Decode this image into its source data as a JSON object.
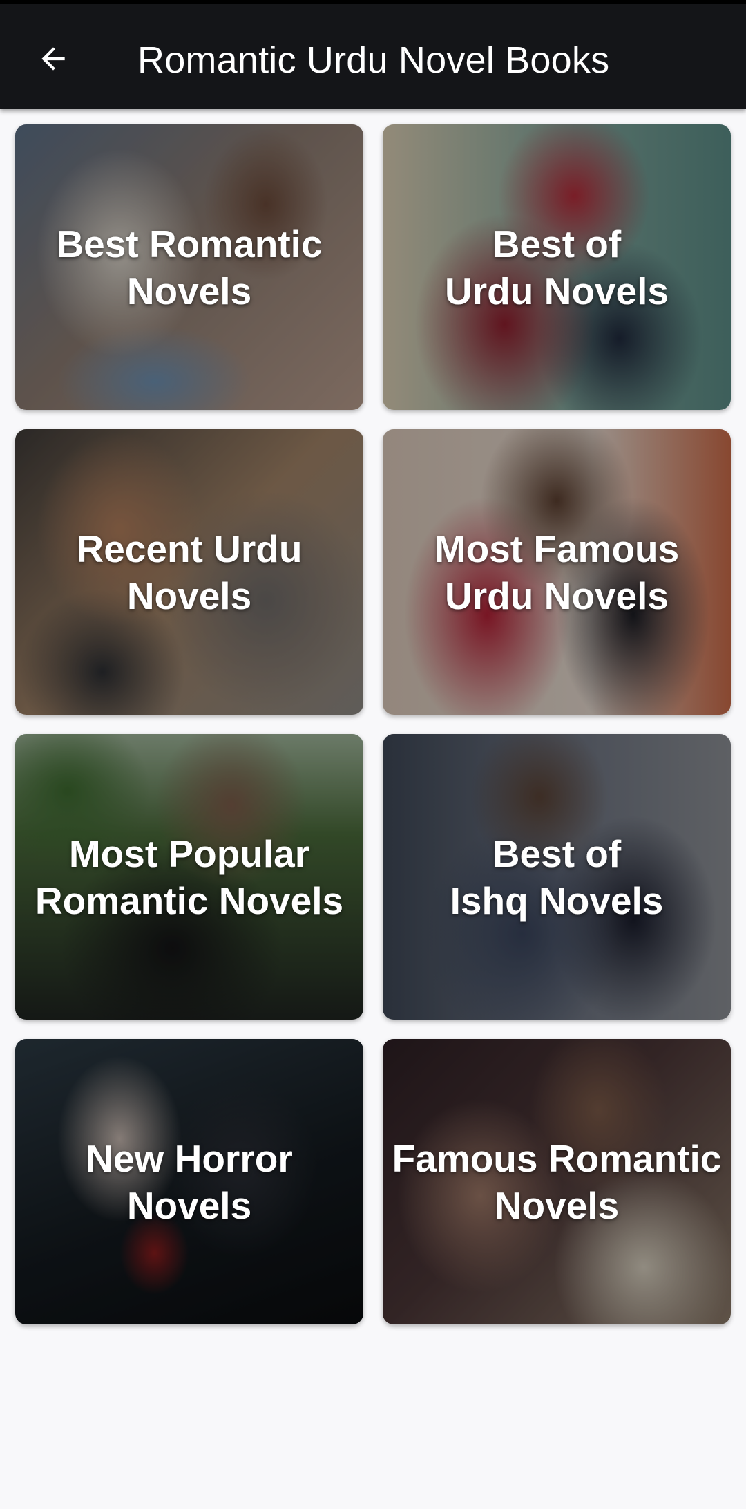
{
  "app_bar": {
    "title": "Romantic Urdu Novel Books",
    "back_icon": "arrow-back-icon",
    "background": "#141518"
  },
  "categories": [
    {
      "label": "Best Romantic\nNovels"
    },
    {
      "label": "Best of\nUrdu Novels"
    },
    {
      "label": "Recent Urdu\nNovels"
    },
    {
      "label": "Most Famous\nUrdu Novels"
    },
    {
      "label": "Most Popular\nRomantic Novels"
    },
    {
      "label": "Best of\nIshq Novels"
    },
    {
      "label": "New Horror\nNovels"
    },
    {
      "label": "Famous Romantic\nNovels"
    }
  ]
}
